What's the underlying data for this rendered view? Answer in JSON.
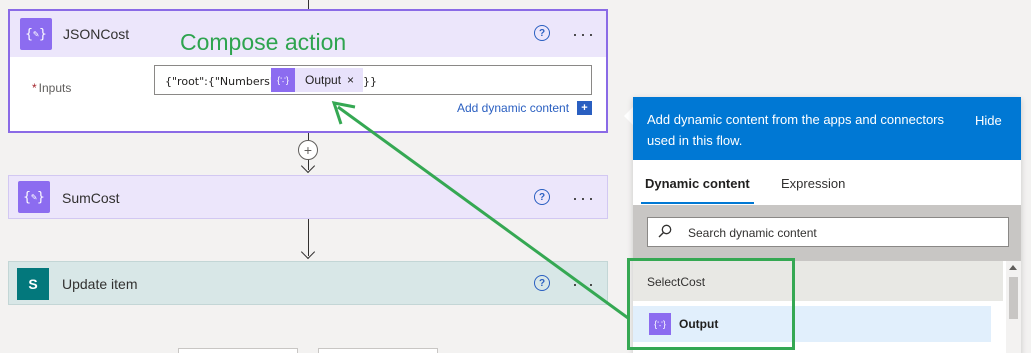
{
  "annotation": {
    "compose_label": "Compose action",
    "color": "#35a853"
  },
  "json_cost": {
    "title": "JSONCost",
    "icon": "compose-icon",
    "inputs_required_mark": "*",
    "inputs_label": "Inputs",
    "input_prefix": "{\"root\":{\"Numbers\":",
    "token_label": "Output",
    "token_close": "×",
    "input_suffix": "}}",
    "add_dynamic_label": "Add dynamic content",
    "add_dynamic_btn": "+",
    "help": "?",
    "more": "···"
  },
  "plus": "+",
  "sum_cost": {
    "title": "SumCost",
    "icon": "compose-icon",
    "help": "?",
    "more": "···"
  },
  "update_item": {
    "title": "Update item",
    "icon": "sharepoint-icon",
    "icon_letter": "S",
    "help": "?",
    "more": "···"
  },
  "dynamic_panel": {
    "header": "Add dynamic content from the apps and connectors used in this flow.",
    "hide": "Hide",
    "tabs": [
      {
        "label": "Dynamic content",
        "active": true
      },
      {
        "label": "Expression",
        "active": false
      }
    ],
    "search_placeholder": "Search dynamic content",
    "section": "SelectCost",
    "items": [
      {
        "label": "Output",
        "icon": "compose-icon"
      }
    ],
    "accent": "#0078d4"
  }
}
